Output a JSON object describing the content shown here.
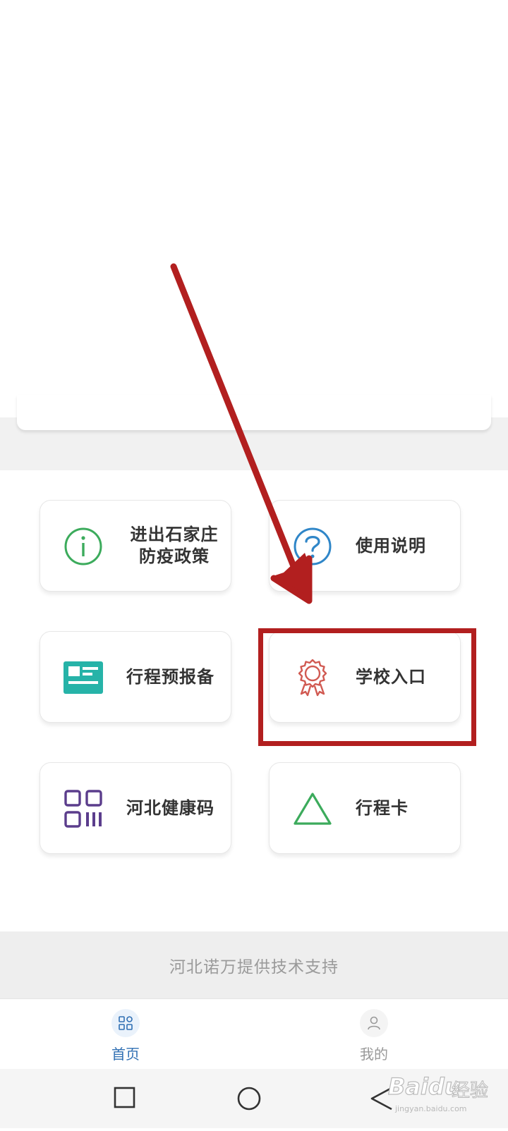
{
  "menu": {
    "items": [
      {
        "id": "policy",
        "lines": [
          "进出石家庄",
          "防疫政策"
        ],
        "icon": "info-circle-icon",
        "icon_color": "#3cab5c"
      },
      {
        "id": "guide",
        "lines": [
          "使用说明"
        ],
        "icon": "question-circle-icon",
        "icon_color": "#2f86c8"
      },
      {
        "id": "trip-report",
        "lines": [
          "行程预报备"
        ],
        "icon": "id-card-icon",
        "icon_color": "#26b3a8"
      },
      {
        "id": "school",
        "lines": [
          "学校入口"
        ],
        "icon": "award-badge-icon",
        "icon_color": "#d15a52"
      },
      {
        "id": "health-code",
        "lines": [
          "河北健康码"
        ],
        "icon": "qr-code-icon",
        "icon_color": "#5b3d8c"
      },
      {
        "id": "trip-card",
        "lines": [
          "行程卡"
        ],
        "icon": "triangle-icon",
        "icon_color": "#3cab5c"
      }
    ]
  },
  "footer": {
    "support_text": "河北诺万提供技术支持"
  },
  "tabbar": {
    "tabs": [
      {
        "label": "首页",
        "icon": "grid-apps-icon",
        "active": true,
        "color": "#2f6fb3"
      },
      {
        "label": "我的",
        "icon": "user-icon",
        "active": false,
        "color": "#999999"
      }
    ]
  },
  "system_nav": {
    "buttons": [
      "recents-square-icon",
      "home-circle-icon",
      "back-triangle-icon"
    ]
  },
  "annotation": {
    "highlight_color": "#b21f1f",
    "target": "学校入口"
  },
  "watermark": {
    "brand": "Baidu",
    "brand_cn": "经验",
    "url": "jingyan.baidu.com"
  }
}
